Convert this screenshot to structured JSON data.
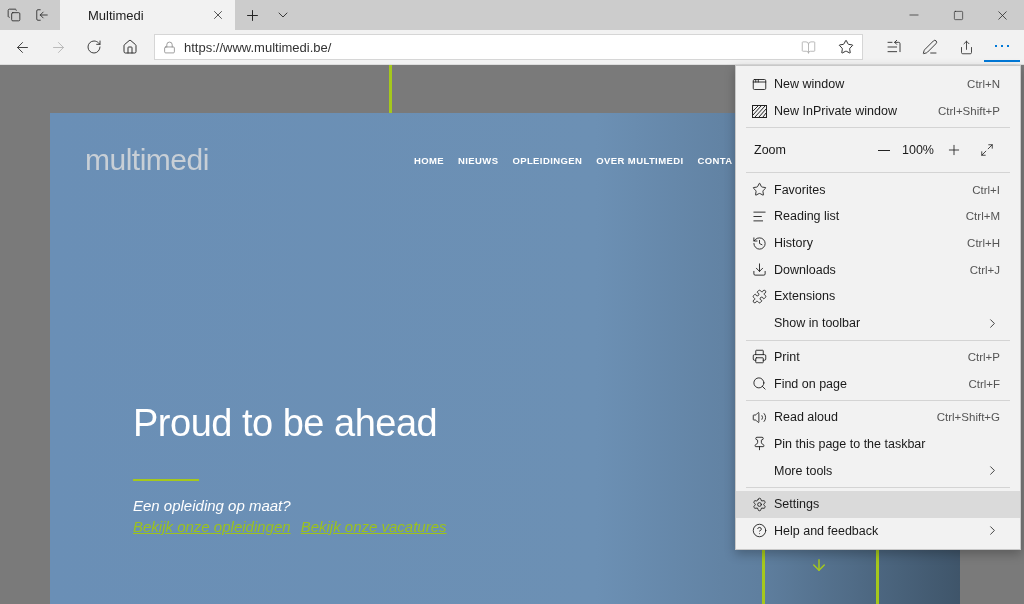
{
  "tabs": [
    {
      "title": "Multimedi",
      "selected": true
    }
  ],
  "toolbar": {
    "forward_disabled": true,
    "address": "https://www.multimedi.be/"
  },
  "website": {
    "logo": "multimedi",
    "nav": [
      {
        "label": "HOME"
      },
      {
        "label": "NIEUWS"
      },
      {
        "label": "OPLEIDINGEN"
      },
      {
        "label": "OVER MULTIMEDI"
      },
      {
        "label": "CONTA"
      }
    ],
    "headline": "Proud to be ahead",
    "subtitle": "Een opleiding op maat?",
    "links": [
      "Bekijk onze opleidingen",
      "Bekijk onze vacatures"
    ]
  },
  "menu": {
    "open": true,
    "groups": [
      {
        "items": [
          {
            "kind": "command",
            "label": "New window",
            "shortcut": "Ctrl+N",
            "submenu": false,
            "selected": false
          },
          {
            "kind": "command",
            "label": "New InPrivate window",
            "shortcut": "Ctrl+Shift+P",
            "submenu": false,
            "selected": false
          }
        ]
      },
      {
        "items": [
          {
            "kind": "zoom",
            "label": "Zoom",
            "value": "100%"
          }
        ]
      },
      {
        "items": [
          {
            "kind": "command",
            "label": "Favorites",
            "shortcut": "Ctrl+I",
            "submenu": false,
            "selected": false
          },
          {
            "kind": "command",
            "label": "Reading list",
            "shortcut": "Ctrl+M",
            "submenu": false,
            "selected": false
          },
          {
            "kind": "command",
            "label": "History",
            "shortcut": "Ctrl+H",
            "submenu": false,
            "selected": false
          },
          {
            "kind": "command",
            "label": "Downloads",
            "shortcut": "Ctrl+J",
            "submenu": false,
            "selected": false
          },
          {
            "kind": "command",
            "label": "Extensions",
            "submenu": false,
            "selected": false
          },
          {
            "kind": "command",
            "label": "Show in toolbar",
            "submenu": true,
            "selected": false
          }
        ]
      },
      {
        "items": [
          {
            "kind": "command",
            "label": "Print",
            "shortcut": "Ctrl+P",
            "submenu": false,
            "selected": false
          },
          {
            "kind": "command",
            "label": "Find on page",
            "shortcut": "Ctrl+F",
            "submenu": false,
            "selected": false
          }
        ]
      },
      {
        "items": [
          {
            "kind": "command",
            "label": "Read aloud",
            "shortcut": "Ctrl+Shift+G",
            "submenu": false,
            "selected": false
          },
          {
            "kind": "command",
            "label": "Pin this page to the taskbar",
            "submenu": false,
            "selected": false
          },
          {
            "kind": "command",
            "label": "More tools",
            "submenu": true,
            "selected": false
          }
        ]
      },
      {
        "items": [
          {
            "kind": "command",
            "label": "Settings",
            "submenu": false,
            "selected": true
          },
          {
            "kind": "command",
            "label": "Help and feedback",
            "submenu": true,
            "selected": false
          }
        ]
      }
    ]
  }
}
